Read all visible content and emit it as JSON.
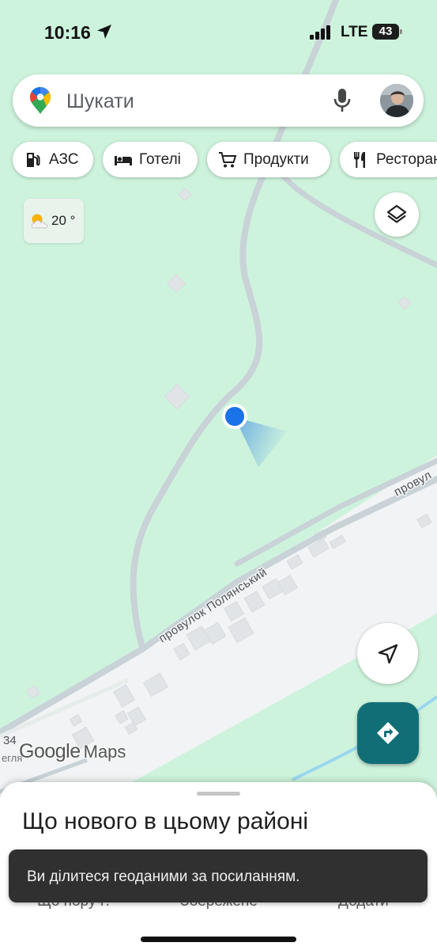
{
  "status_bar": {
    "time": "10:16",
    "network": "LTE",
    "battery": "43"
  },
  "search": {
    "placeholder": "Шукати"
  },
  "chips": [
    {
      "label": "АЗС",
      "icon": "gas-station-icon"
    },
    {
      "label": "Готелі",
      "icon": "hotel-bed-icon"
    },
    {
      "label": "Продукти",
      "icon": "shopping-cart-icon"
    },
    {
      "label": "Ресторани",
      "icon": "restaurant-icon"
    }
  ],
  "weather": {
    "temperature": "20 °",
    "icon": "partly-cloudy-icon"
  },
  "map": {
    "street_label": "провулок Полянський",
    "street_label_2": "провул",
    "edge_number": "34",
    "edge_text": "егля",
    "watermark_google": "Google",
    "watermark_maps": "Maps",
    "colors": {
      "land": "#cdf3dc",
      "road": "#c8d2d7",
      "built_area": "#f1f3f4",
      "building": "#e1e4e6",
      "water": "#9ad7ef",
      "location_dot": "#1a73e8",
      "directions_button": "#116e77"
    }
  },
  "sheet": {
    "title": "Що нового в цьому районі",
    "tabs": [
      "Що поруч?",
      "Збережене",
      "Додати"
    ]
  },
  "snackbar": {
    "text": "Ви ділитеся геоданими за посиланням."
  }
}
